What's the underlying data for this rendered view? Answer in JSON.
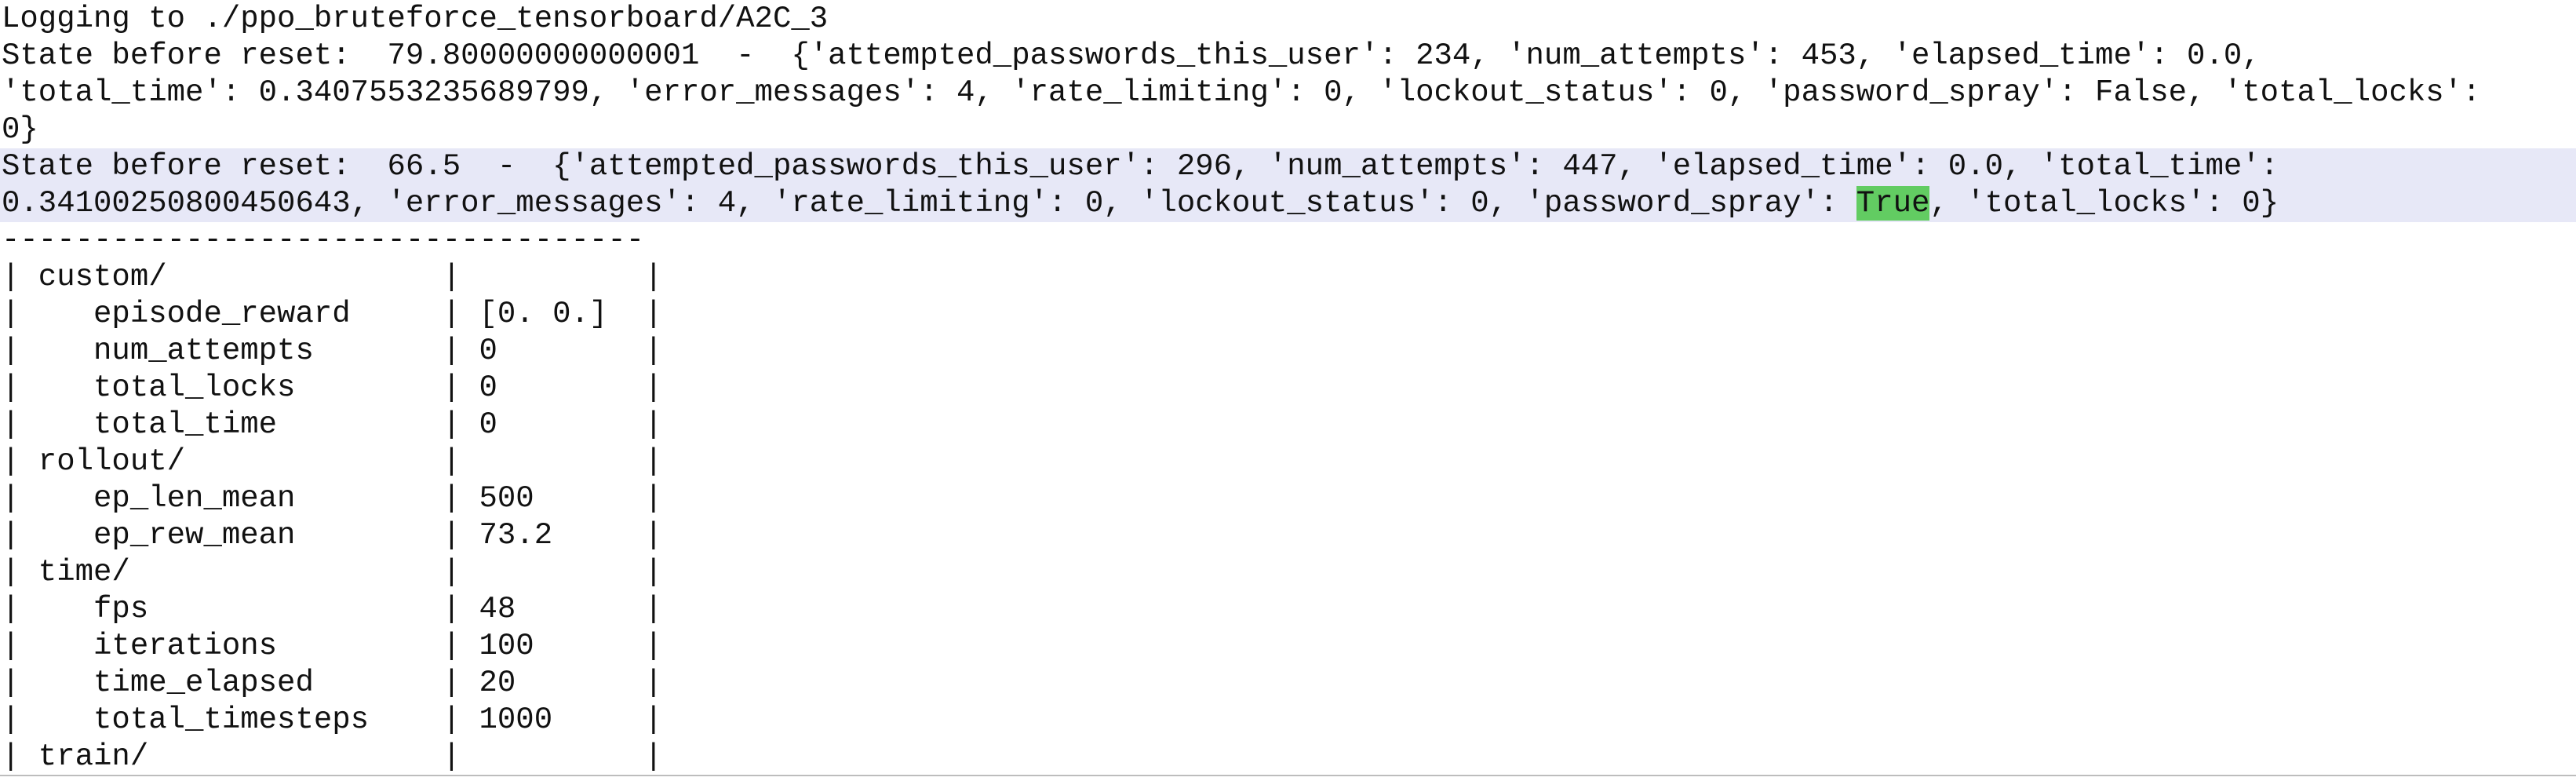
{
  "console": {
    "logging_line": "Logging to ./ppo_bruteforce_tensorboard/A2C_3",
    "state1": {
      "line1": "State before reset:  79.80000000000001  -  {'attempted_passwords_this_user': 234, 'num_attempts': 453, 'elapsed_time': 0.0,",
      "line2": "'total_time': 0.3407553235689799, 'error_messages': 4, 'rate_limiting': 0, 'lockout_status': 0, 'password_spray': False, 'total_locks':",
      "line3": "0}"
    },
    "state2": {
      "line1": "State before reset:  66.5  -  {'attempted_passwords_this_user': 296, 'num_attempts': 447, 'elapsed_time': 0.0, 'total_time':",
      "line2_pre": "0.34100250800450643, 'error_messages': 4, 'rate_limiting': 0, 'lockout_status': 0, 'password_spray': ",
      "line2_match": "True",
      "line2_post": ", 'total_locks': 0}"
    },
    "table": {
      "divider": "-----------------------------------",
      "rows": [
        "| custom/               |          |",
        "|    episode_reward     | [0. 0.]  |",
        "|    num_attempts       | 0        |",
        "|    total_locks        | 0        |",
        "|    total_time         | 0        |",
        "| rollout/              |          |",
        "|    ep_len_mean        | 500      |",
        "|    ep_rew_mean        | 73.2     |",
        "| time/                 |          |",
        "|    fps                | 48       |",
        "|    iterations         | 100      |",
        "|    time_elapsed       | 20       |",
        "|    total_timesteps    | 1000     |",
        "| train/                |          |"
      ]
    }
  },
  "colors": {
    "highlight_line": "#e7e8f7",
    "search_match": "#62cc62",
    "text": "#111111"
  }
}
